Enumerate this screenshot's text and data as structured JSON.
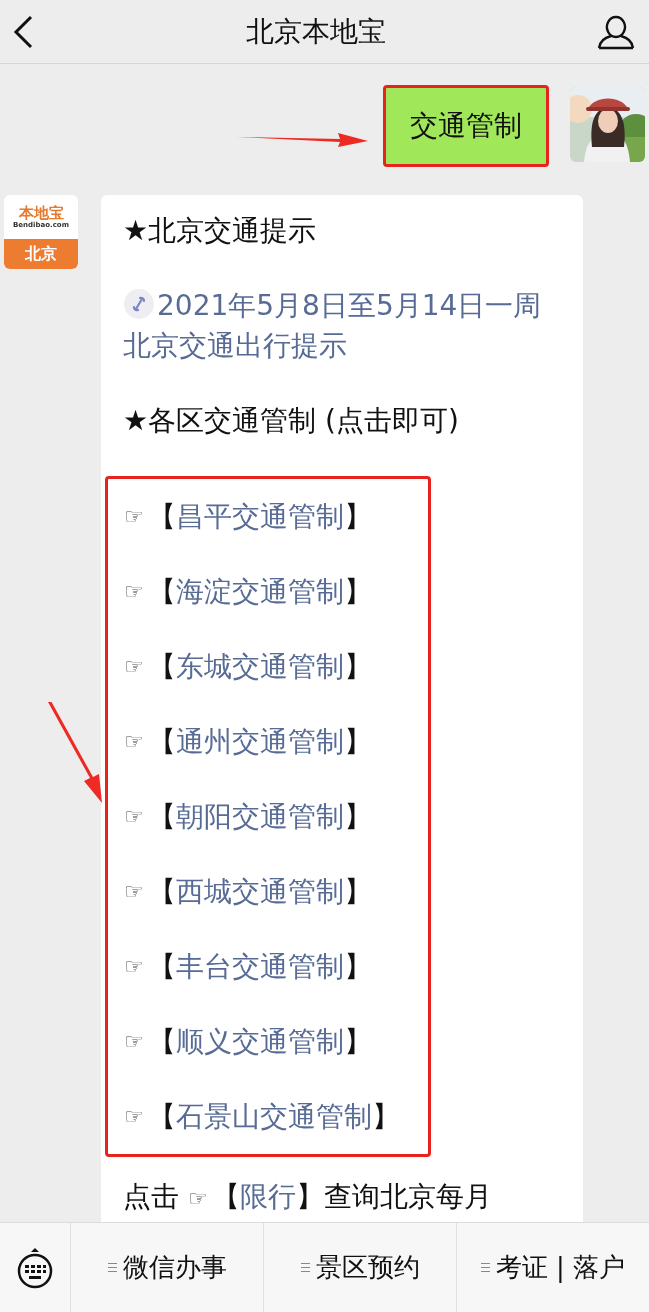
{
  "header": {
    "title": "北京本地宝"
  },
  "sent_message": {
    "text": "交通管制",
    "highlighted": true
  },
  "logo": {
    "name": "本地宝",
    "domain": "Bendibao.com",
    "city": "北京"
  },
  "article": {
    "heading": "★北京交通提示",
    "link": "2021年5月8日至5月14日一周北京交通出行提示",
    "section": "★各区交通管制 (点击即可)",
    "list_highlighted": true,
    "district_links": [
      {
        "pointer": "☞",
        "open": "【",
        "label": "昌平交通管制",
        "close": "】"
      },
      {
        "pointer": "☞",
        "open": "【",
        "label": "海淀交通管制",
        "close": "】"
      },
      {
        "pointer": "☞",
        "open": "【",
        "label": "东城交通管制",
        "close": "】"
      },
      {
        "pointer": "☞",
        "open": "【",
        "label": "通州交通管制",
        "close": "】"
      },
      {
        "pointer": "☞",
        "open": "【",
        "label": "朝阳交通管制",
        "close": "】"
      },
      {
        "pointer": "☞",
        "open": "【",
        "label": "西城交通管制",
        "close": "】"
      },
      {
        "pointer": "☞",
        "open": "【",
        "label": "丰台交通管制",
        "close": "】"
      },
      {
        "pointer": "☞",
        "open": "【",
        "label": "顺义交通管制",
        "close": "】"
      },
      {
        "pointer": "☞",
        "open": "【",
        "label": "石景山交通管制",
        "close": "】"
      }
    ],
    "footer": [
      {
        "kind": "plain",
        "text": "点击 "
      },
      {
        "kind": "pointer",
        "text": "☞"
      },
      {
        "kind": "plain",
        "text": "【"
      },
      {
        "kind": "link",
        "text": "限行"
      },
      {
        "kind": "plain",
        "text": "】查询北京每月"
      }
    ]
  },
  "bottom_menu": [
    {
      "label": "微信办事"
    },
    {
      "label": "景区预约"
    },
    {
      "label": "考证 | 落户"
    }
  ]
}
